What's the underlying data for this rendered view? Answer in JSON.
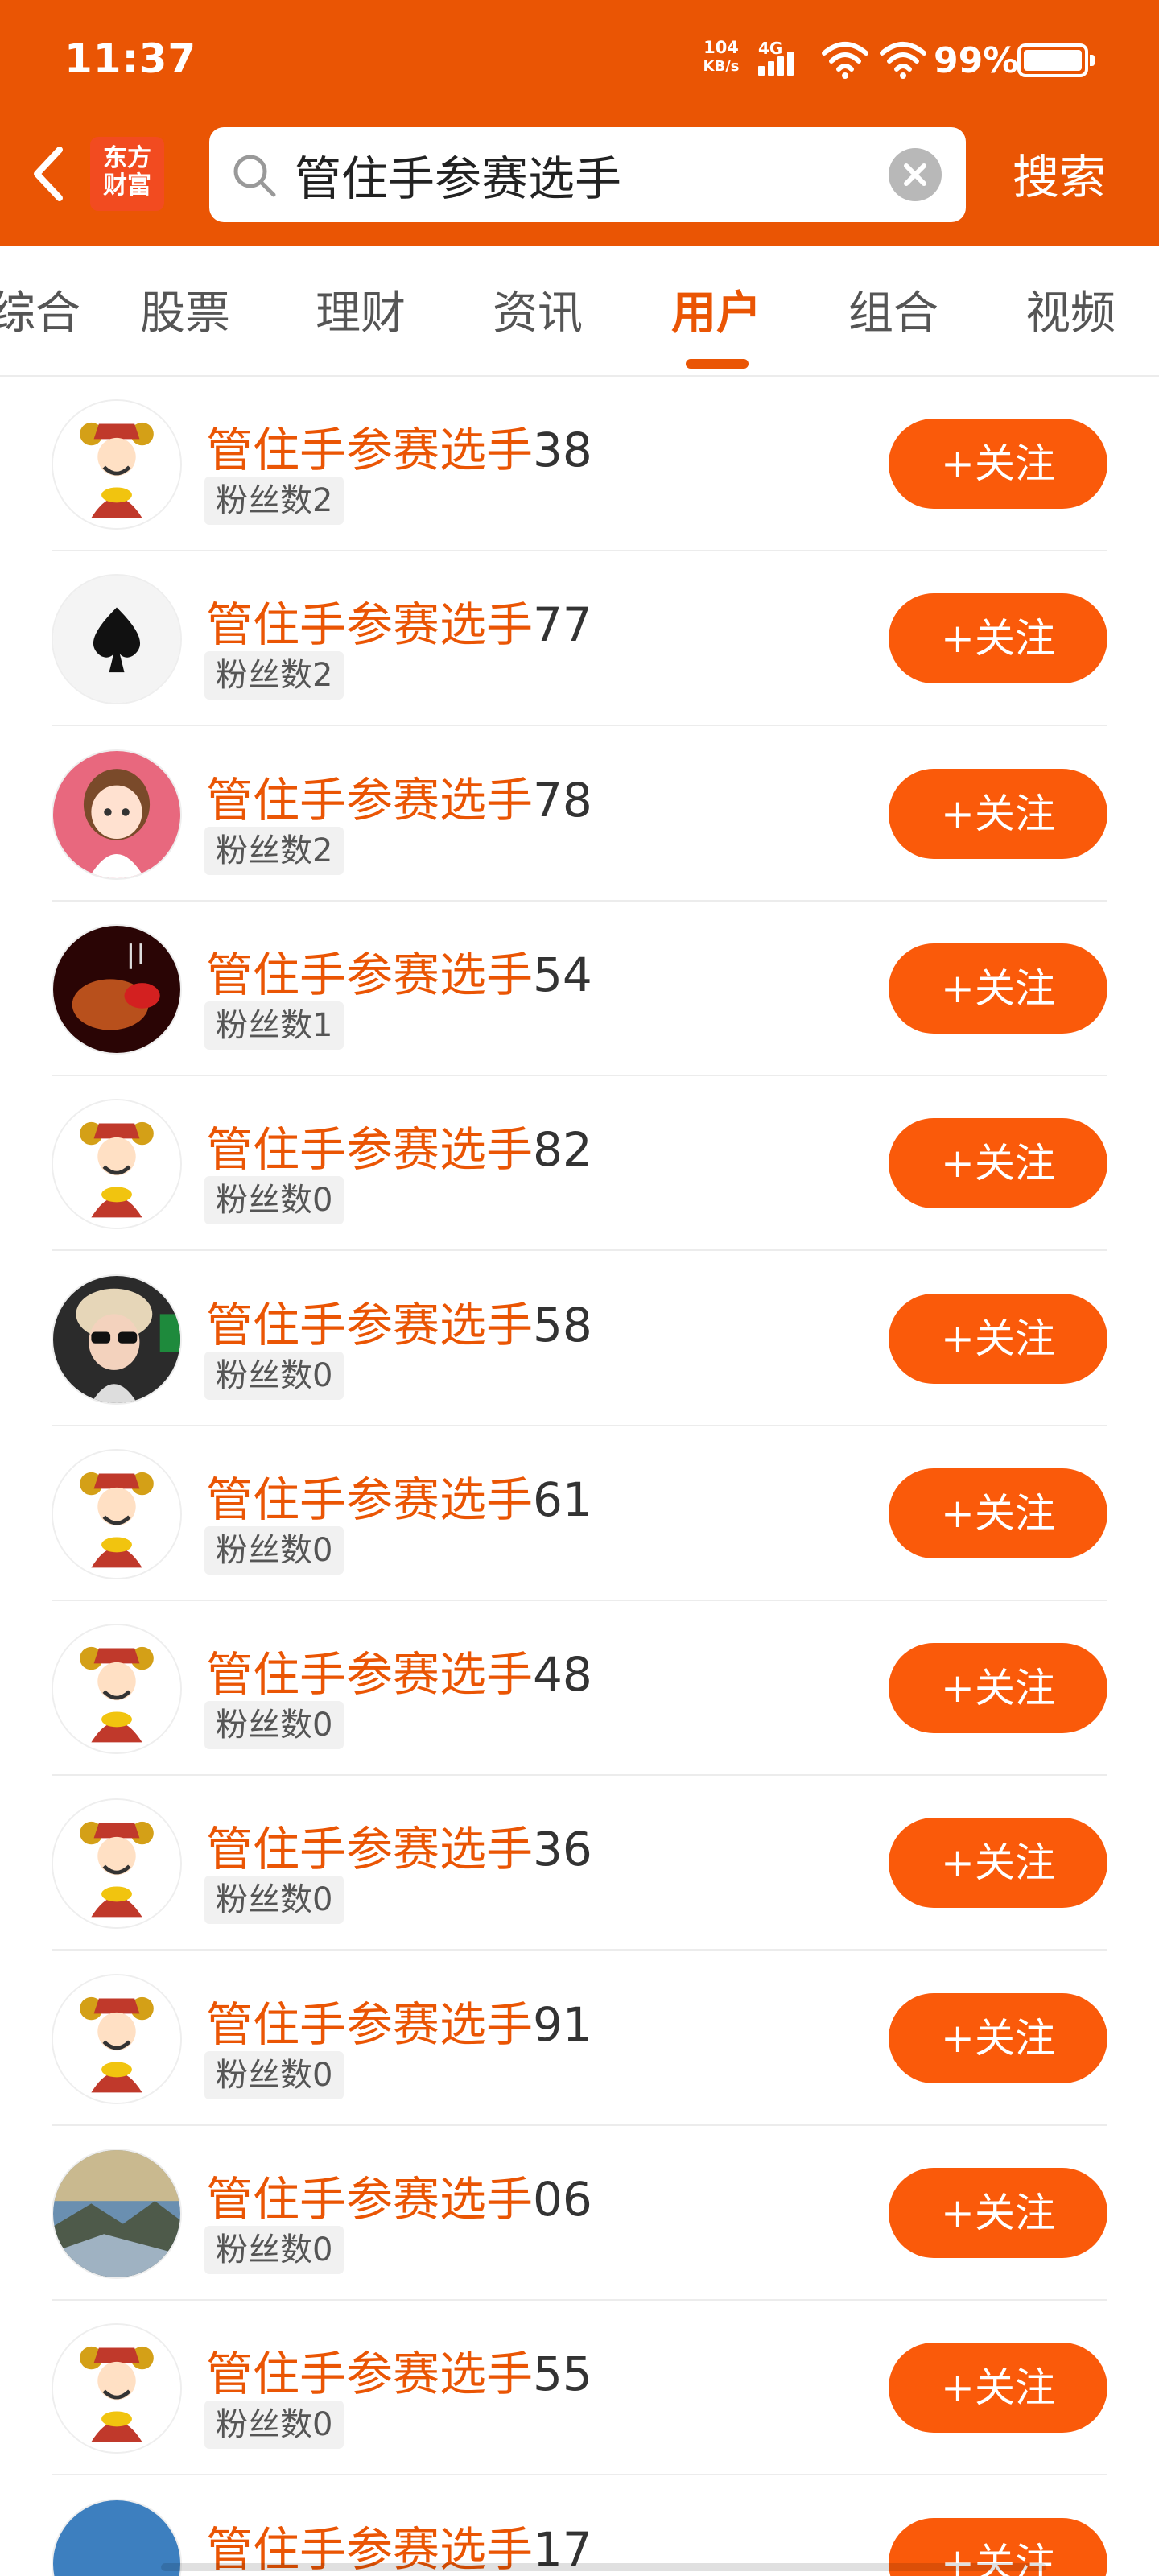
{
  "status_bar": {
    "time": "11:37",
    "net_speed_value": "104",
    "net_speed_unit": "KB/s",
    "network_type": "4G",
    "battery_percent": "99%"
  },
  "header": {
    "logo_line1": "东方",
    "logo_line2": "财富",
    "search_value": "管住手参赛选手",
    "search_button": "搜索"
  },
  "tabs": [
    {
      "label": "综合",
      "active": false
    },
    {
      "label": "股票",
      "active": false
    },
    {
      "label": "理财",
      "active": false
    },
    {
      "label": "资讯",
      "active": false
    },
    {
      "label": "用户",
      "active": true
    },
    {
      "label": "组合",
      "active": false
    },
    {
      "label": "视频",
      "active": false
    }
  ],
  "colors": {
    "brand_orange": "#ea5504",
    "button_orange": "#fa5a0a"
  },
  "users": [
    {
      "name_prefix": "管住手参赛选手",
      "name_number": "38",
      "fans": "粉丝数2",
      "avatar": "god-of-wealth-avatar",
      "follow": "+关注"
    },
    {
      "name_prefix": "管住手参赛选手",
      "name_number": "77",
      "fans": "粉丝数2",
      "avatar": "spade-avatar",
      "follow": "+关注"
    },
    {
      "name_prefix": "管住手参赛选手",
      "name_number": "78",
      "fans": "粉丝数2",
      "avatar": "cartoon-girl-avatar",
      "follow": "+关注"
    },
    {
      "name_prefix": "管住手参赛选手",
      "name_number": "54",
      "fans": "粉丝数1",
      "avatar": "red-photo-avatar",
      "follow": "+关注"
    },
    {
      "name_prefix": "管住手参赛选手",
      "name_number": "82",
      "fans": "粉丝数0",
      "avatar": "god-of-wealth-avatar",
      "follow": "+关注"
    },
    {
      "name_prefix": "管住手参赛选手",
      "name_number": "58",
      "fans": "粉丝数0",
      "avatar": "child-sunglasses-avatar",
      "follow": "+关注"
    },
    {
      "name_prefix": "管住手参赛选手",
      "name_number": "61",
      "fans": "粉丝数0",
      "avatar": "god-of-wealth-avatar",
      "follow": "+关注"
    },
    {
      "name_prefix": "管住手参赛选手",
      "name_number": "48",
      "fans": "粉丝数0",
      "avatar": "god-of-wealth-avatar",
      "follow": "+关注"
    },
    {
      "name_prefix": "管住手参赛选手",
      "name_number": "36",
      "fans": "粉丝数0",
      "avatar": "god-of-wealth-avatar",
      "follow": "+关注"
    },
    {
      "name_prefix": "管住手参赛选手",
      "name_number": "91",
      "fans": "粉丝数0",
      "avatar": "god-of-wealth-avatar",
      "follow": "+关注"
    },
    {
      "name_prefix": "管住手参赛选手",
      "name_number": "06",
      "fans": "粉丝数0",
      "avatar": "landscape-avatar",
      "follow": "+关注"
    },
    {
      "name_prefix": "管住手参赛选手",
      "name_number": "55",
      "fans": "粉丝数0",
      "avatar": "god-of-wealth-avatar",
      "follow": "+关注"
    },
    {
      "name_prefix": "管住手参赛选手",
      "name_number": "17",
      "fans": "",
      "avatar": "sky-avatar",
      "follow": "+关注"
    }
  ]
}
